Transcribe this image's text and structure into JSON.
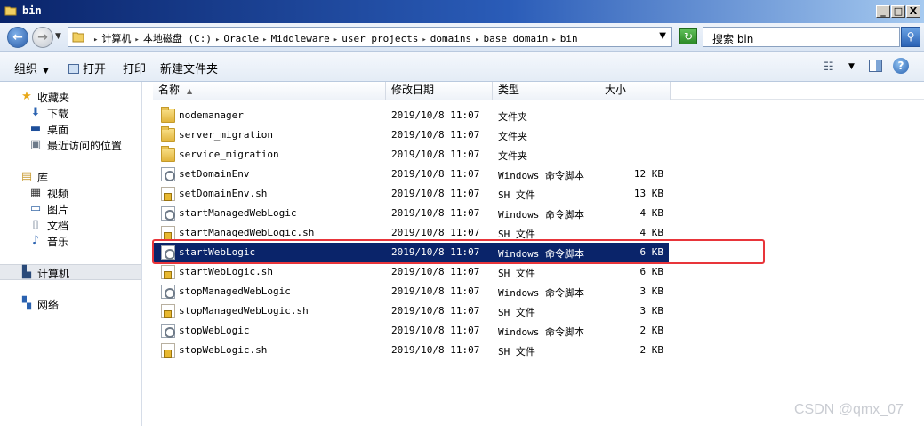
{
  "window": {
    "title": "bin",
    "min_label": "_",
    "max_label": "□",
    "close_label": "X"
  },
  "address": {
    "breadcrumbs": [
      "计算机",
      "本地磁盘 (C:)",
      "Oracle",
      "Middleware",
      "user_projects",
      "domains",
      "base_domain",
      "bin"
    ],
    "search_placeholder": "搜索 bin"
  },
  "toolbar": {
    "organize": "组织",
    "open": "打开",
    "print": "打印",
    "new_folder": "新建文件夹"
  },
  "sidebar": {
    "favorites": {
      "label": "收藏夹",
      "icon": "star-icon",
      "items": [
        {
          "label": "下载",
          "icon": "download-folder-icon"
        },
        {
          "label": "桌面",
          "icon": "desktop-icon"
        },
        {
          "label": "最近访问的位置",
          "icon": "recent-places-icon"
        }
      ]
    },
    "libraries": {
      "label": "库",
      "icon": "library-icon",
      "items": [
        {
          "label": "视频",
          "icon": "video-icon"
        },
        {
          "label": "图片",
          "icon": "picture-icon"
        },
        {
          "label": "文档",
          "icon": "document-icon"
        },
        {
          "label": "音乐",
          "icon": "music-icon"
        }
      ]
    },
    "computer": {
      "label": "计算机",
      "icon": "computer-icon"
    },
    "network": {
      "label": "网络",
      "icon": "network-icon"
    }
  },
  "columns": {
    "name": "名称",
    "modified": "修改日期",
    "type": "类型",
    "size": "大小"
  },
  "files": [
    {
      "name": "nodemanager",
      "modified": "2019/10/8 11:07",
      "type": "文件夹",
      "size": "",
      "icon": "folder"
    },
    {
      "name": "server_migration",
      "modified": "2019/10/8 11:07",
      "type": "文件夹",
      "size": "",
      "icon": "folder"
    },
    {
      "name": "service_migration",
      "modified": "2019/10/8 11:07",
      "type": "文件夹",
      "size": "",
      "icon": "folder"
    },
    {
      "name": "setDomainEnv",
      "modified": "2019/10/8 11:07",
      "type": "Windows 命令脚本",
      "size": "12 KB",
      "icon": "cmd"
    },
    {
      "name": "setDomainEnv.sh",
      "modified": "2019/10/8 11:07",
      "type": "SH 文件",
      "size": "13 KB",
      "icon": "sh"
    },
    {
      "name": "startManagedWebLogic",
      "modified": "2019/10/8 11:07",
      "type": "Windows 命令脚本",
      "size": "4 KB",
      "icon": "cmd"
    },
    {
      "name": "startManagedWebLogic.sh",
      "modified": "2019/10/8 11:07",
      "type": "SH 文件",
      "size": "4 KB",
      "icon": "sh"
    },
    {
      "name": "startWebLogic",
      "modified": "2019/10/8 11:07",
      "type": "Windows 命令脚本",
      "size": "6 KB",
      "icon": "cmd",
      "selected": true
    },
    {
      "name": "startWebLogic.sh",
      "modified": "2019/10/8 11:07",
      "type": "SH 文件",
      "size": "6 KB",
      "icon": "sh"
    },
    {
      "name": "stopManagedWebLogic",
      "modified": "2019/10/8 11:07",
      "type": "Windows 命令脚本",
      "size": "3 KB",
      "icon": "cmd"
    },
    {
      "name": "stopManagedWebLogic.sh",
      "modified": "2019/10/8 11:07",
      "type": "SH 文件",
      "size": "3 KB",
      "icon": "sh"
    },
    {
      "name": "stopWebLogic",
      "modified": "2019/10/8 11:07",
      "type": "Windows 命令脚本",
      "size": "2 KB",
      "icon": "cmd"
    },
    {
      "name": "stopWebLogic.sh",
      "modified": "2019/10/8 11:07",
      "type": "SH 文件",
      "size": "2 KB",
      "icon": "sh"
    }
  ],
  "watermark": "CSDN @qmx_07",
  "colors": {
    "selection": "#0a246a",
    "highlight_border": "#e8353a"
  }
}
